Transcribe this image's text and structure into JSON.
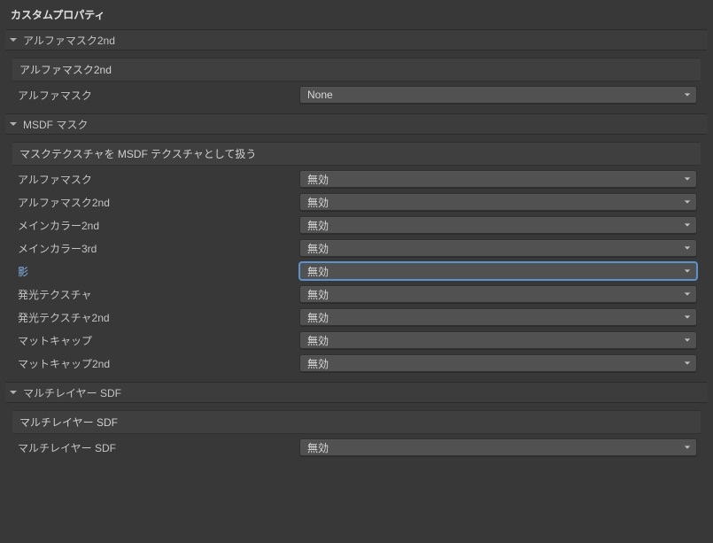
{
  "title": "カスタムプロパティ",
  "sections": {
    "alphaMask2nd": {
      "header": "アルファマスク2nd",
      "subheader": "アルファマスク2nd",
      "rows": {
        "alphaMask": {
          "label": "アルファマスク",
          "value": "None"
        }
      }
    },
    "msdfMask": {
      "header": "MSDF マスク",
      "subheader": "マスクテクスチャを MSDF テクスチャとして扱う",
      "rows": {
        "alphaMask": {
          "label": "アルファマスク",
          "value": "無効"
        },
        "alphaMask2nd": {
          "label": "アルファマスク2nd",
          "value": "無効"
        },
        "mainColor2nd": {
          "label": "メインカラー2nd",
          "value": "無効"
        },
        "mainColor3rd": {
          "label": "メインカラー3rd",
          "value": "無効"
        },
        "shadow": {
          "label": "影",
          "value": "無効"
        },
        "emission": {
          "label": "発光テクスチャ",
          "value": "無効"
        },
        "emission2nd": {
          "label": "発光テクスチャ2nd",
          "value": "無効"
        },
        "matcap": {
          "label": "マットキャップ",
          "value": "無効"
        },
        "matcap2nd": {
          "label": "マットキャップ2nd",
          "value": "無効"
        }
      }
    },
    "multiLayerSdf": {
      "header": "マルチレイヤー SDF",
      "subheader": "マルチレイヤー SDF",
      "rows": {
        "multiLayerSdf": {
          "label": "マルチレイヤー SDF",
          "value": "無効"
        }
      }
    }
  }
}
